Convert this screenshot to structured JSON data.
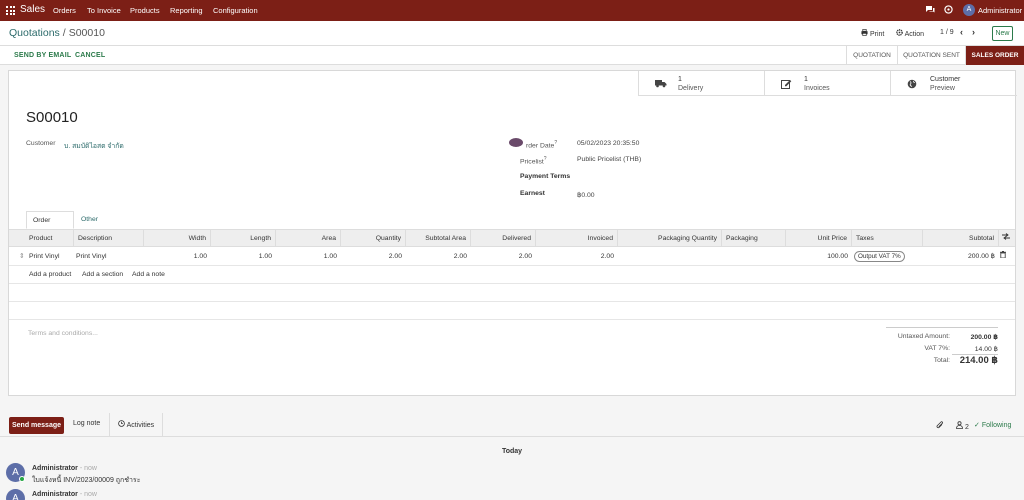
{
  "navbar": {
    "brand": "Sales",
    "menu": [
      "Orders",
      "To Invoice",
      "Products",
      "Reporting",
      "Configuration"
    ],
    "user": "Administrator",
    "avatar_letter": "A",
    "icons": [
      "apps-grid-icon",
      "chat-icon",
      "help-icon"
    ]
  },
  "control": {
    "breadcrumb_parent": "Quotations",
    "breadcrumb_sep": "/",
    "breadcrumb_current": "S00010",
    "print_label": "Print",
    "action_label": "Action",
    "pager": "1 / 9",
    "new_label": "New"
  },
  "statusbar": {
    "send_email": "SEND BY EMAIL",
    "cancel": "CANCEL",
    "stages": [
      "QUOTATION",
      "QUOTATION SENT",
      "SALES ORDER"
    ],
    "active_stage": "SALES ORDER"
  },
  "smart_buttons": [
    {
      "value": "1",
      "label": "Delivery",
      "icon": "truck-icon"
    },
    {
      "value": "1",
      "label": "Invoices",
      "icon": "edit-icon"
    },
    {
      "value": "Customer",
      "label": "Preview",
      "icon": "globe-icon"
    }
  ],
  "form": {
    "name": "S00010",
    "customer_label": "Customer",
    "customer_value": "บ. สมบัติไอสต จำกัด",
    "order_date_label": "rder Date",
    "order_date_value": "05/02/2023 20:35:50",
    "pricelist_label": "Pricelist",
    "pricelist_value": "Public Pricelist (THB)",
    "payment_terms_label": "Payment Terms",
    "earnest_label": "Earnest",
    "earnest_value": "฿0.00",
    "help_mark": "?"
  },
  "tabs": [
    "Order Lines",
    "Other Info"
  ],
  "table": {
    "headers": [
      "Product",
      "Description",
      "Width",
      "Length",
      "Area",
      "Quantity",
      "Subtotal Area",
      "Delivered",
      "Invoiced",
      "Packaging Quantity",
      "Packaging",
      "Unit Price",
      "Taxes",
      "Subtotal"
    ],
    "row": {
      "product": "Print Vinyl",
      "description": "Print Vinyl",
      "width": "1.00",
      "length": "1.00",
      "area": "1.00",
      "quantity": "2.00",
      "subtotal_area": "2.00",
      "delivered": "2.00",
      "invoiced": "2.00",
      "packaging_quantity": "",
      "packaging": "",
      "unit_price": "100.00",
      "taxes": "Output VAT 7%",
      "subtotal": "200.00 ฿"
    },
    "add_product": "Add a product",
    "add_section": "Add a section",
    "add_note": "Add a note"
  },
  "terms_placeholder": "Terms and conditions...",
  "totals": {
    "untaxed_label": "Untaxed Amount:",
    "untaxed_value": "200.00 ฿",
    "vat_label": "VAT 7%:",
    "vat_value": "14.00 ฿",
    "total_label": "Total:",
    "total_value": "214.00 ฿"
  },
  "chatter": {
    "send_message": "Send message",
    "log_note": "Log note",
    "activities": "Activities",
    "followers_count": "2",
    "following": "Following",
    "today": "Today",
    "messages": [
      {
        "author": "Administrator",
        "time": "- now",
        "body": "ใบแจ้งหนี้ INV/2023/00009 ถูกชำระ"
      },
      {
        "author": "Administrator",
        "time": "- now",
        "body": ""
      }
    ]
  }
}
